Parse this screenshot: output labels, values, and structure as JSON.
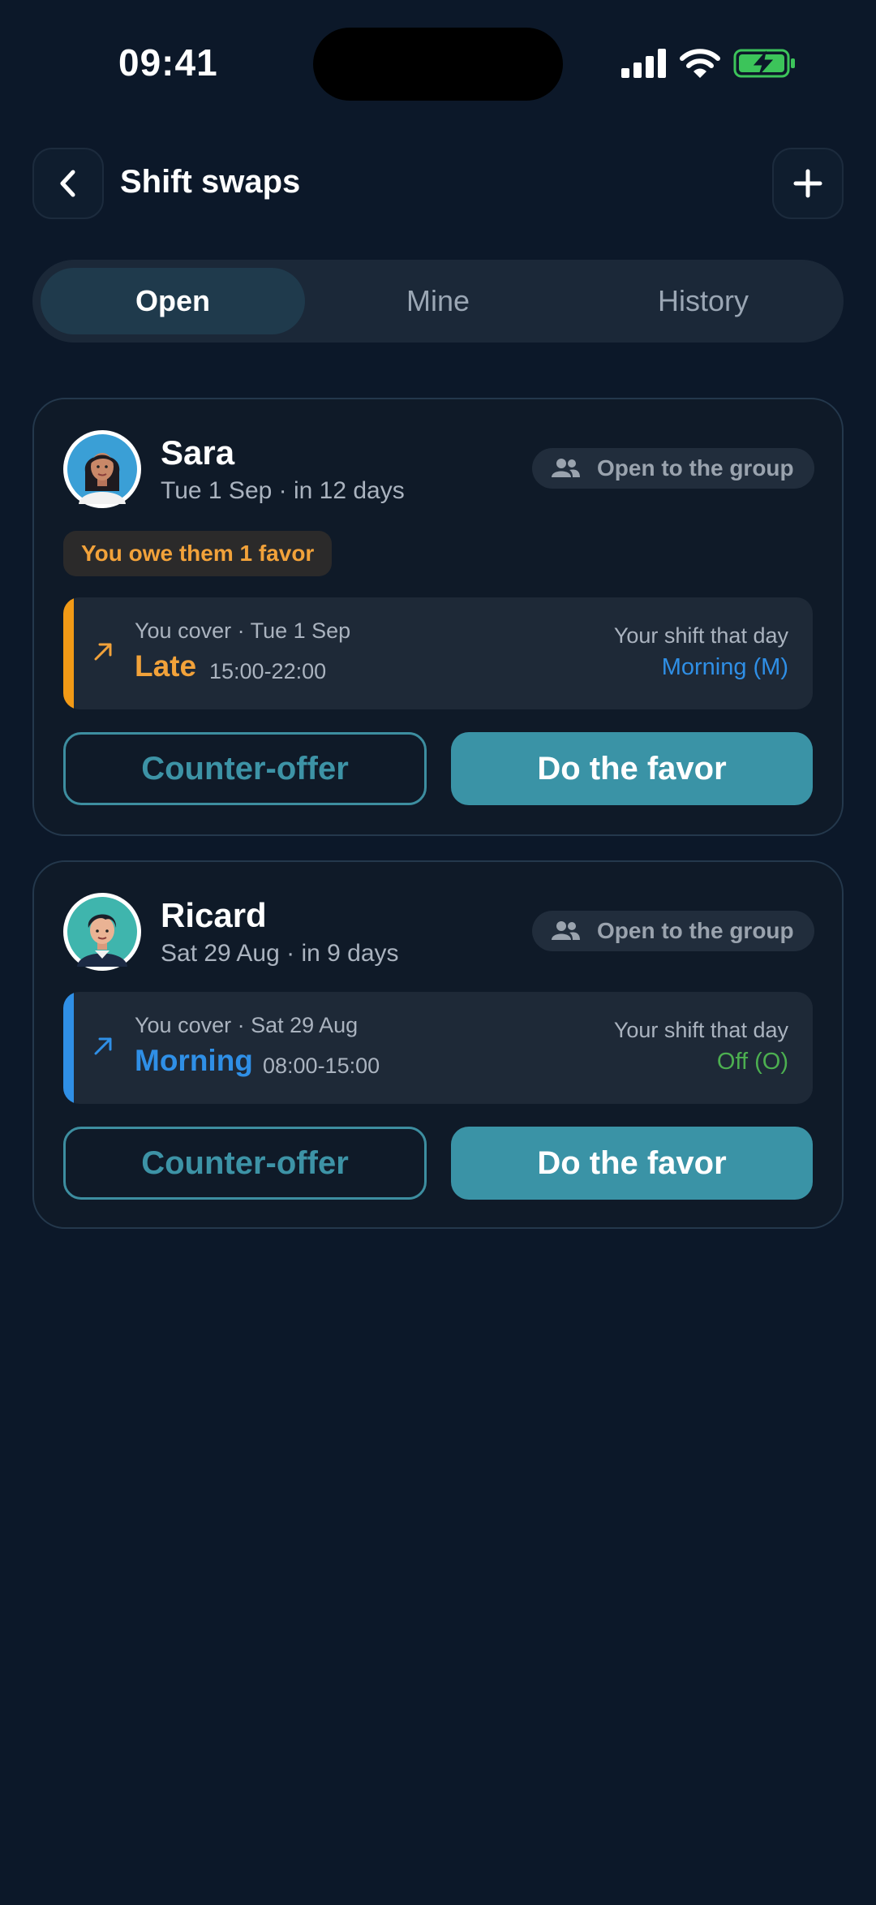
{
  "status_bar": {
    "time": "09:41"
  },
  "header": {
    "title": "Shift swaps",
    "back_icon": "chevron-left-icon",
    "add_icon": "plus-icon"
  },
  "tabs": [
    {
      "label": "Open",
      "active": true
    },
    {
      "label": "Mine",
      "active": false
    },
    {
      "label": "History",
      "active": false
    }
  ],
  "swaps": [
    {
      "name": "Sara",
      "date": "Tue 1 Sep · in 12 days",
      "visibility": "Open to the group",
      "favor_badge": "You owe them 1 favor",
      "cover_label": "You cover · Tue 1 Sep",
      "shift_name": "Late",
      "shift_hours": "15:00-22:00",
      "your_shift_label": "Your shift that day",
      "your_shift_value": "Morning (M)",
      "counter_label": "Counter-offer",
      "favor_label": "Do the favor"
    },
    {
      "name": "Ricard",
      "date": "Sat 29 Aug · in 9 days",
      "visibility": "Open to the group",
      "cover_label": "You cover · Sat 29 Aug",
      "shift_name": "Morning",
      "shift_hours": "08:00-15:00",
      "your_shift_label": "Your shift that day",
      "your_shift_value": "Off (O)",
      "counter_label": "Counter-offer",
      "favor_label": "Do the favor"
    }
  ],
  "colors": {
    "background": "#0c1829",
    "accent": "#3a93a6",
    "late": "#f2a23a",
    "morning": "#2f8fe6",
    "off": "#4caf50"
  }
}
